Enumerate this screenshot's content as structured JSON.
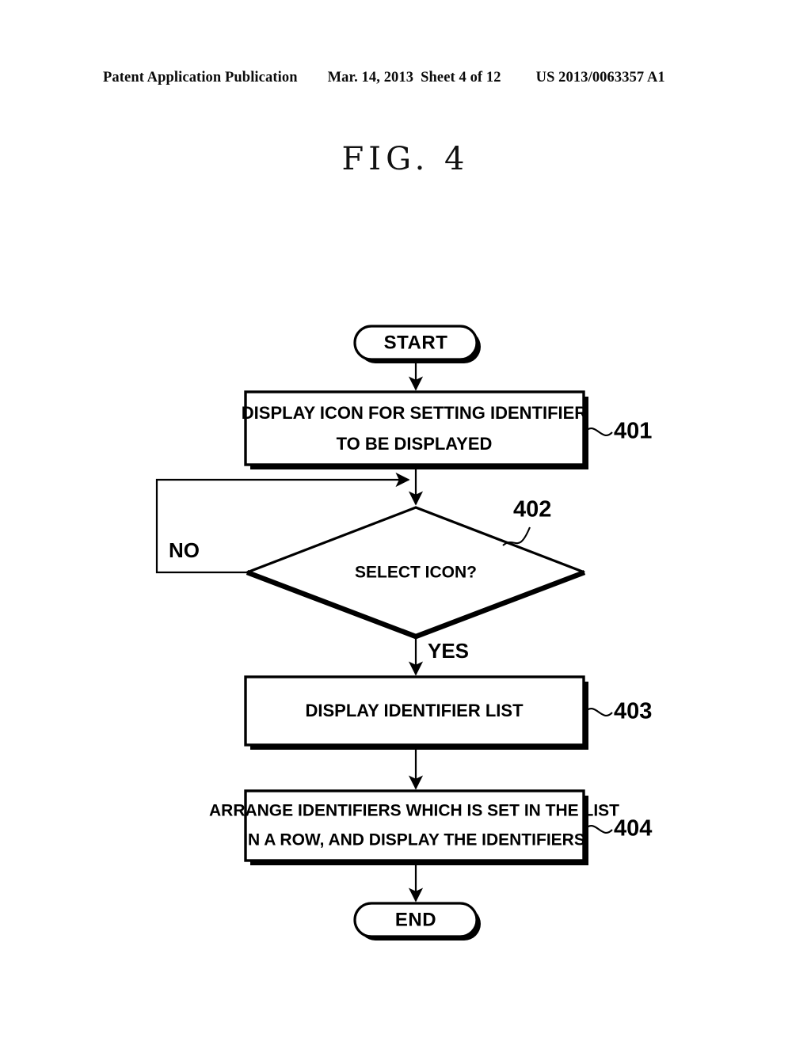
{
  "header": {
    "publication": "Patent Application Publication",
    "date": "Mar. 14, 2013",
    "sheet": "Sheet 4 of 12",
    "pub_number": "US 2013/0063357 A1"
  },
  "figure": {
    "title": "FIG. 4"
  },
  "flowchart": {
    "start_label": "START",
    "end_label": "END",
    "branch_no": "NO",
    "branch_yes": "YES",
    "steps": [
      {
        "ref": "401",
        "type": "process",
        "line1": "DISPLAY ICON FOR SETTING IDENTIFIER",
        "line2": "TO BE DISPLAYED"
      },
      {
        "ref": "402",
        "type": "decision",
        "line1": "SELECT ICON?",
        "line2": ""
      },
      {
        "ref": "403",
        "type": "process",
        "line1": "DISPLAY IDENTIFIER LIST",
        "line2": ""
      },
      {
        "ref": "404",
        "type": "process",
        "line1": "ARRANGE IDENTIFIERS WHICH IS SET IN THE LIST",
        "line2": "IN A ROW, AND DISPLAY THE IDENTIFIERS"
      }
    ]
  },
  "colors": {
    "ink": "#000000",
    "page": "#ffffff"
  }
}
